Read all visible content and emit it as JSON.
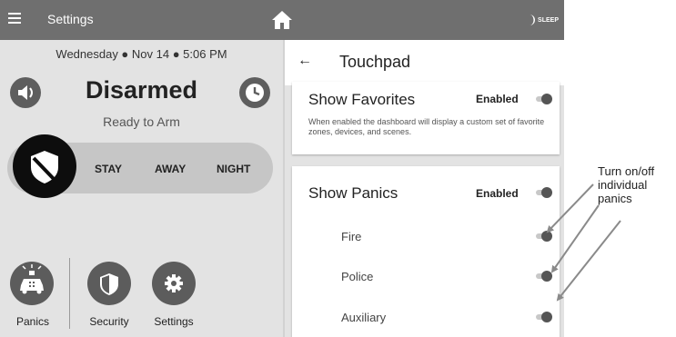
{
  "topbar": {
    "menu_icon": "hamburger-menu-icon",
    "title": "Settings",
    "home_icon": "home-icon",
    "sleep_label": "SLEEP",
    "sleep_icon": "moon-icon"
  },
  "security_panel": {
    "datetime": "Wednesday  ●  Nov 14  ●  5:06 PM",
    "state": "Disarmed",
    "substate": "Ready to Arm",
    "sound_icon": "speaker-icon",
    "history_icon": "clock-icon",
    "arm_icon": "shield-icon",
    "modes": [
      "STAY",
      "AWAY",
      "NIGHT"
    ],
    "bottom_buttons": [
      {
        "label": "Panics",
        "icon": "police-car-icon"
      },
      {
        "label": "Security",
        "icon": "shield-icon"
      },
      {
        "label": "Settings",
        "icon": "gear-icon"
      }
    ]
  },
  "touchpad": {
    "back_icon": "back-arrow-icon",
    "back_glyph": "←",
    "title": "Touchpad",
    "favorites": {
      "title": "Show Favorites",
      "status": "Enabled",
      "enabled": true,
      "description": "When enabled the dashboard will display a custom set of favorite zones, devices, and scenes."
    },
    "panics": {
      "title": "Show Panics",
      "status": "Enabled",
      "enabled": true,
      "items": [
        {
          "label": "Fire",
          "enabled": true
        },
        {
          "label": "Police",
          "enabled": true
        },
        {
          "label": "Auxiliary",
          "enabled": true
        }
      ]
    }
  },
  "annotation": {
    "line1": "Turn on/off",
    "line2": "individual",
    "line3": "panics"
  }
}
